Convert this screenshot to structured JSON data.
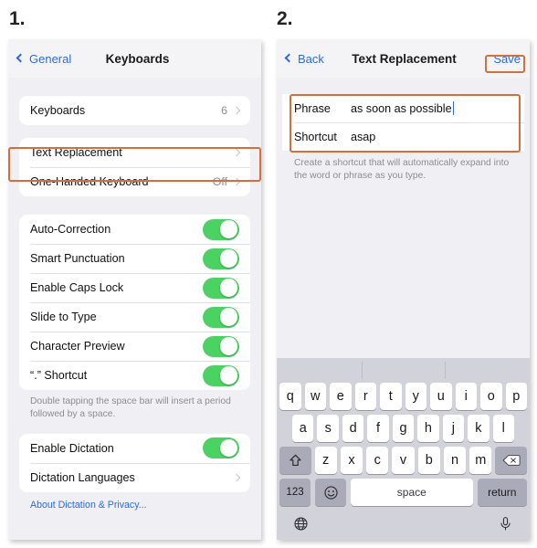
{
  "steps": {
    "one": "1.",
    "two": "2."
  },
  "screen1": {
    "nav": {
      "back_label": "General",
      "back_icon": "chevron-left-icon",
      "title": "Keyboards"
    },
    "section_keyboards": {
      "rows": [
        {
          "label": "Keyboards",
          "value": "6",
          "accessory": "chevron-right-icon"
        }
      ]
    },
    "section_replacement": {
      "rows": [
        {
          "label": "Text Replacement",
          "value": "",
          "accessory": "chevron-right-icon",
          "highlighted": true
        },
        {
          "label": "One-Handed Keyboard",
          "value": "Off",
          "accessory": "chevron-right-icon",
          "highlighted": false
        }
      ]
    },
    "section_typing": {
      "rows": [
        {
          "label": "Auto-Correction",
          "toggle": "on"
        },
        {
          "label": "Smart Punctuation",
          "toggle": "on"
        },
        {
          "label": "Enable Caps Lock",
          "toggle": "on"
        },
        {
          "label": "Slide to Type",
          "toggle": "on"
        },
        {
          "label": "Character Preview",
          "toggle": "on"
        },
        {
          "label": "“.” Shortcut",
          "toggle": "on"
        }
      ],
      "footnote": "Double tapping the space bar will insert a period followed by a space."
    },
    "section_dictation": {
      "rows": [
        {
          "label": "Enable Dictation",
          "toggle": "on"
        },
        {
          "label": "Dictation Languages",
          "value": "",
          "accessory": "chevron-right-icon"
        }
      ],
      "link": "About Dictation & Privacy..."
    }
  },
  "screen2": {
    "nav": {
      "back_label": "Back",
      "back_icon": "chevron-left-icon",
      "title": "Text Replacement",
      "save_label": "Save"
    },
    "fields": [
      {
        "key": "Phrase",
        "value": "as soon as possible",
        "focused": true
      },
      {
        "key": "Shortcut",
        "value": "asap",
        "focused": false
      }
    ],
    "footnote": "Create a shortcut that will automatically expand into the word or phrase as you type.",
    "keyboard": {
      "suggestions": [
        "",
        "",
        ""
      ],
      "row1": [
        "q",
        "w",
        "e",
        "r",
        "t",
        "y",
        "u",
        "i",
        "o",
        "p"
      ],
      "row2": [
        "a",
        "s",
        "d",
        "f",
        "g",
        "h",
        "j",
        "k",
        "l"
      ],
      "row3": [
        "z",
        "x",
        "c",
        "v",
        "b",
        "n",
        "m"
      ],
      "shift_icon": "shift-icon",
      "delete_icon": "backspace-icon",
      "numbers_label": "123",
      "emoji_icon": "emoji-icon",
      "space_label": "space",
      "return_label": "return",
      "globe_icon": "globe-icon",
      "mic_icon": "microphone-icon"
    }
  },
  "colors": {
    "highlight": "#d1703f",
    "accent_blue": "#2d6cdf",
    "toggle_on": "#4cd263",
    "panel_bg": "#efeff4",
    "keyboard_bg": "#d1d2da"
  }
}
